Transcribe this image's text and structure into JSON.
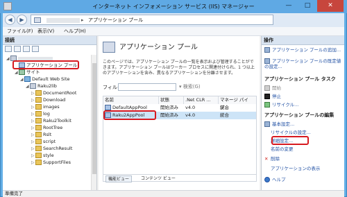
{
  "window": {
    "title": "インターネット インフォメーション サービス (IIS) マネージャー",
    "min_glyph": "—",
    "max_glyph": "□",
    "close_glyph": "✕"
  },
  "address": {
    "back_glyph": "◀",
    "forward_glyph": "▶",
    "separator": "▸",
    "page": "アプリケーション プール"
  },
  "menu": {
    "items": [
      "ファイル(F)",
      "表示(V)",
      "ヘルプ(H)"
    ]
  },
  "connections": {
    "header": "接続",
    "tree": [
      {
        "label": "アプリケーション プール",
        "expander": ""
      },
      {
        "label": "サイト",
        "expander": "◢"
      },
      {
        "label": "Default Web Site",
        "expander": "◢"
      },
      {
        "label": "Raku2lib",
        "expander": "◢"
      },
      {
        "label": "DocumentRoot",
        "expander": "▷"
      },
      {
        "label": "Download",
        "expander": "▷"
      },
      {
        "label": "images",
        "expander": "▷"
      },
      {
        "label": "log",
        "expander": "▷"
      },
      {
        "label": "Raku2Toolkit",
        "expander": "▷"
      },
      {
        "label": "RootTree",
        "expander": "▷"
      },
      {
        "label": "Rslt",
        "expander": "▷"
      },
      {
        "label": "script",
        "expander": "▷"
      },
      {
        "label": "SearchResult",
        "expander": "▷"
      },
      {
        "label": "style",
        "expander": "▷"
      },
      {
        "label": "SupportFiles",
        "expander": "▷"
      }
    ]
  },
  "center": {
    "title": "アプリケーション プール",
    "description": "このページでは、アプリケーション プールの一覧を表示および管理することができます。アプリケーション プールはワーカー プロセスに関連付けられ、1 つ以上のアプリケーションを含み、異なるアプリケーションを分離させます。",
    "filter_label": "フィルター:",
    "search_label": "▾ 検索(G)",
    "columns": [
      "名前",
      "状態",
      ".Net CLR ...",
      "マネージ パイプ..."
    ],
    "rows": [
      {
        "name": "DefaultAppPool",
        "status": "開始済み",
        "clr": "v4.0",
        "pipeline": "統合"
      },
      {
        "name": "Raku2AppPool",
        "status": "開始済み",
        "clr": "v4.0",
        "pipeline": "統合"
      }
    ],
    "tab_features": "機能ビュー",
    "tab_content": "コンテンツ ビュー"
  },
  "actions": {
    "header": "操作",
    "items": [
      {
        "label": "アプリケーション プールの追加...",
        "kind": "link"
      },
      {
        "label": "アプリケーション プールの既定値の設定...",
        "kind": "link"
      },
      {
        "label": "アプリケーション プール タスク",
        "kind": "header"
      },
      {
        "label": "開始",
        "kind": "disabled"
      },
      {
        "label": "停止",
        "kind": "link"
      },
      {
        "label": "リサイクル...",
        "kind": "link"
      },
      {
        "label": "アプリケーション プールの編集",
        "kind": "header"
      },
      {
        "label": "基本設定...",
        "kind": "link"
      },
      {
        "label": "リサイクルの設定...",
        "kind": "link"
      },
      {
        "label": "詳細設定...",
        "kind": "link"
      },
      {
        "label": "名前の変更",
        "kind": "link"
      },
      {
        "label": "削除",
        "kind": "link"
      },
      {
        "label": "アプリケーションの表示",
        "kind": "link"
      },
      {
        "label": "ヘルプ",
        "kind": "link"
      }
    ]
  },
  "status": {
    "text": "準備完了"
  },
  "colors": {
    "accent": "#1f4fa3",
    "highlight": "#d7191f",
    "title_bar": "#5fa9e4"
  }
}
